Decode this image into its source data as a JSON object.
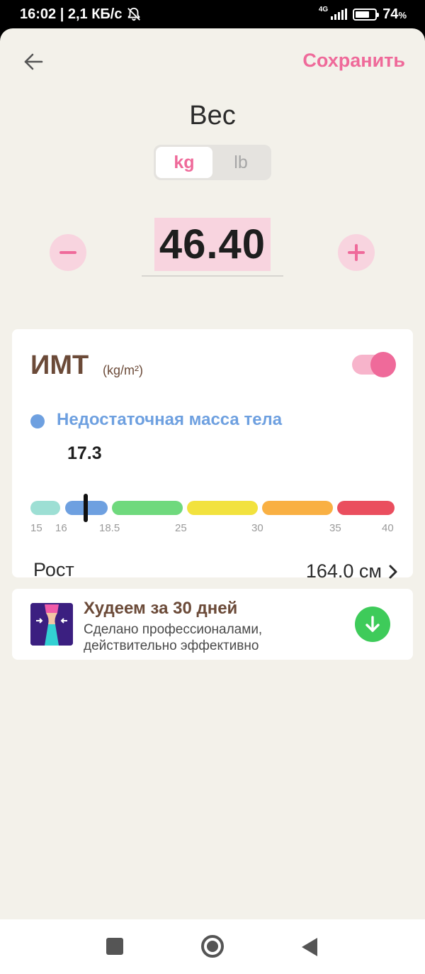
{
  "status_bar": {
    "time_speed": "16:02 | 2,1 КБ/с",
    "network": "4G",
    "battery_percent": "74",
    "battery_sign": "%",
    "battery_level": 0.74
  },
  "header": {
    "save_label": "Сохранить",
    "title": "Вес"
  },
  "unit_toggle": {
    "options": [
      "kg",
      "lb"
    ],
    "selected": "kg"
  },
  "weight": {
    "value": "46.40",
    "minus_icon": "minus-icon",
    "plus_icon": "plus-icon"
  },
  "bmi": {
    "title": "ИМТ",
    "unit": "(kg/m²)",
    "enabled": true,
    "status": "Недостаточная масса тела",
    "value": "17.3",
    "scale_ticks": [
      "15",
      "16",
      "18.5",
      "25",
      "30",
      "35",
      "40"
    ],
    "segment_colors": [
      "#9ddfd4",
      "#6ea0e0",
      "#6fd97d",
      "#f2e23e",
      "#f9b043",
      "#ea4e5e"
    ]
  },
  "height": {
    "label": "Рост",
    "value": "164.0 см"
  },
  "promo": {
    "title": "Худеем за 30 дней",
    "line1": "Сделано профессионалами,",
    "line2": "действительно эффективно"
  },
  "colors": {
    "accent": "#ef6a9a",
    "background": "#f3f1ea",
    "bmi_status": "#6ea0e0",
    "download": "#3ecb5a"
  }
}
